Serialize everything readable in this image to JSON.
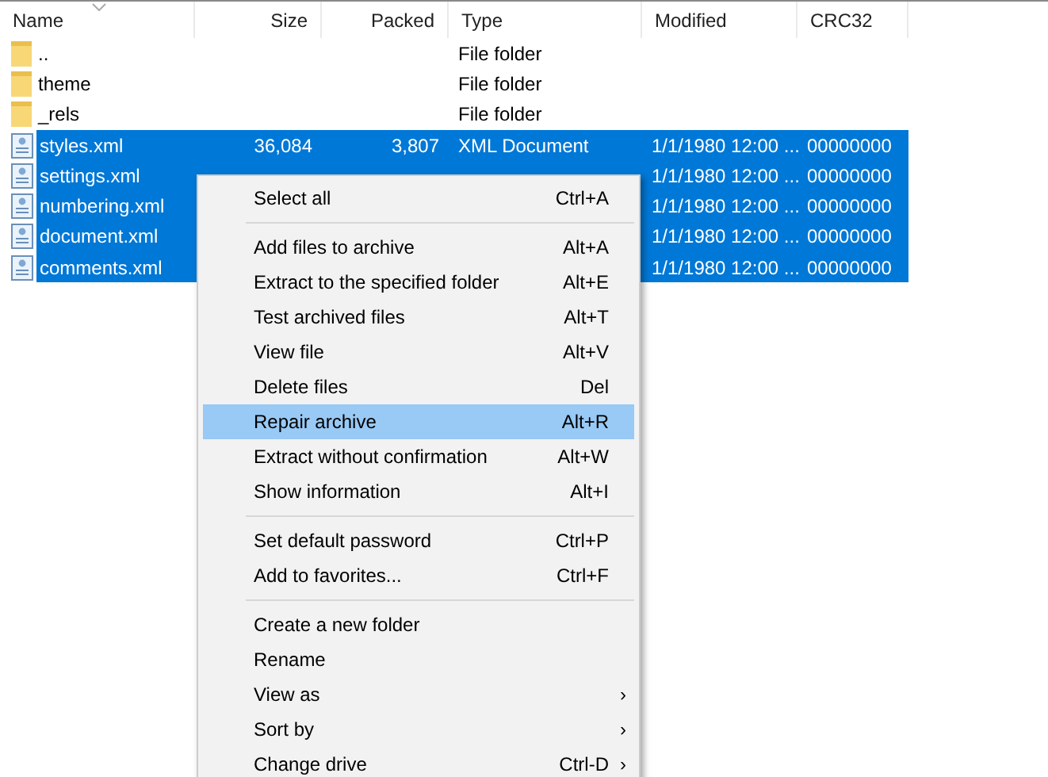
{
  "table": {
    "columns": [
      {
        "label": "Name"
      },
      {
        "label": "Size"
      },
      {
        "label": "Packed"
      },
      {
        "label": "Type"
      },
      {
        "label": "Modified"
      },
      {
        "label": "CRC32"
      }
    ],
    "rows": [
      {
        "kind": "folder",
        "name": "..",
        "type": "File folder",
        "selected": false
      },
      {
        "kind": "folder",
        "name": "theme",
        "type": "File folder",
        "selected": false
      },
      {
        "kind": "folder",
        "name": "_rels",
        "type": "File folder",
        "selected": false
      },
      {
        "kind": "xml",
        "name": "styles.xml",
        "size": "36,084",
        "packed": "3,807",
        "type": "XML Document",
        "modified": "1/1/1980 12:00 ...",
        "crc": "00000000",
        "selected": true
      },
      {
        "kind": "xml",
        "name": "settings.xml",
        "modified": "1/1/1980 12:00 ...",
        "crc": "00000000",
        "selected": true
      },
      {
        "kind": "xml",
        "name": "numbering.xml",
        "modified": "1/1/1980 12:00 ...",
        "crc": "00000000",
        "selected": true
      },
      {
        "kind": "xml",
        "name": "document.xml",
        "modified": "1/1/1980 12:00 ...",
        "crc": "00000000",
        "selected": true
      },
      {
        "kind": "xml",
        "name": "comments.xml",
        "modified": "1/1/1980 12:00 ...",
        "crc": "00000000",
        "selected": true
      }
    ]
  },
  "context_menu": {
    "items": [
      {
        "kind": "item",
        "label": "Select all",
        "shortcut": "Ctrl+A",
        "highlighted": false
      },
      {
        "kind": "separator"
      },
      {
        "kind": "item",
        "label": "Add files to archive",
        "shortcut": "Alt+A",
        "highlighted": false
      },
      {
        "kind": "item",
        "label": "Extract to the specified folder",
        "shortcut": "Alt+E",
        "highlighted": false
      },
      {
        "kind": "item",
        "label": "Test archived files",
        "shortcut": "Alt+T",
        "highlighted": false
      },
      {
        "kind": "item",
        "label": "View file",
        "shortcut": "Alt+V",
        "highlighted": false
      },
      {
        "kind": "item",
        "label": "Delete files",
        "shortcut": "Del",
        "highlighted": false
      },
      {
        "kind": "item",
        "label": "Repair archive",
        "shortcut": "Alt+R",
        "highlighted": true
      },
      {
        "kind": "item",
        "label": "Extract without confirmation",
        "shortcut": "Alt+W",
        "highlighted": false
      },
      {
        "kind": "item",
        "label": "Show information",
        "shortcut": "Alt+I",
        "highlighted": false
      },
      {
        "kind": "separator"
      },
      {
        "kind": "item",
        "label": "Set default password",
        "shortcut": "Ctrl+P",
        "highlighted": false
      },
      {
        "kind": "item",
        "label": "Add to favorites...",
        "shortcut": "Ctrl+F",
        "highlighted": false
      },
      {
        "kind": "separator"
      },
      {
        "kind": "item",
        "label": "Create a new folder",
        "highlighted": false
      },
      {
        "kind": "item",
        "label": "Rename",
        "highlighted": false
      },
      {
        "kind": "item",
        "label": "View as",
        "submenu": "›",
        "highlighted": false
      },
      {
        "kind": "item",
        "label": "Sort by",
        "submenu": "›",
        "highlighted": false
      },
      {
        "kind": "item",
        "label": "Change drive",
        "shortcut": "Ctrl-D",
        "submenu": "›",
        "highlighted": false
      }
    ]
  }
}
